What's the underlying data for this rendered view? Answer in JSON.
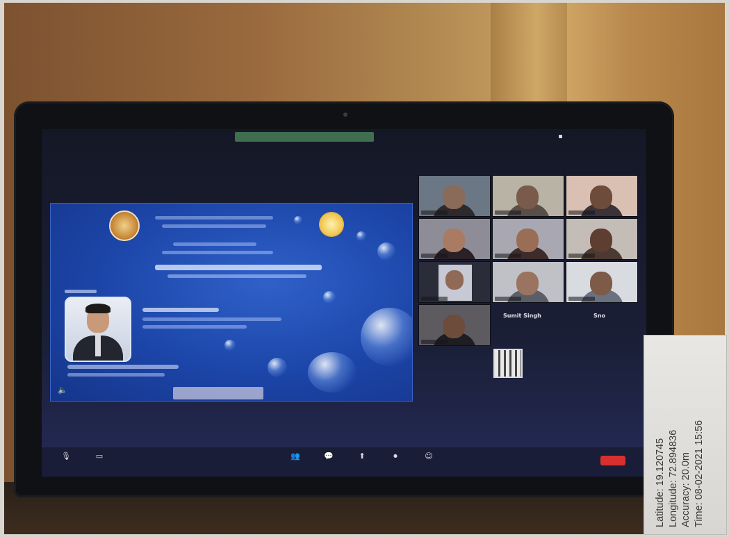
{
  "geotag": {
    "latitude": "Latitude: 19.120745",
    "longitude": "Longitude: 72.894836",
    "accuracy": "Accuracy: 20.0m",
    "time": "Time: 08-02-2021 15:56"
  },
  "gallery": {
    "participant_label_1": "Sumit Singh",
    "participant_label_2": "Sno"
  },
  "icons": {
    "audio": "speaker-icon",
    "mute": "microphone-icon",
    "video": "camera-icon",
    "participants": "participants-icon",
    "chat": "chat-icon",
    "share": "share-screen-icon",
    "record": "record-icon",
    "reactions": "reactions-icon"
  },
  "colors": {
    "slide_blue": "#1c45a8",
    "end_button": "#d7302f",
    "recording_bar": "#3f6f4f"
  }
}
